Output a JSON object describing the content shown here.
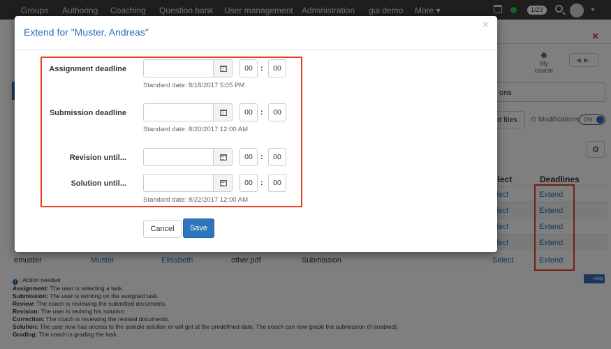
{
  "topnav": {
    "items": [
      "Groups",
      "Authoring",
      "Coaching",
      "Question bank",
      "User management",
      "Administration",
      "gui demo",
      "More ▾"
    ],
    "page_count": "1/23"
  },
  "background": {
    "my_course": "My course",
    "options_fragment": "ons",
    "files_fragment": "d files",
    "modifications": "Modifications",
    "toggle_state": "ON",
    "columns": {
      "select": "elect",
      "deadlines": "Deadlines"
    },
    "select_fragment": "elect",
    "extend_label": "Extend",
    "select_label": "Select",
    "emuster_row": {
      "login": "emuster",
      "lastname": "Muster",
      "firstname": "Elisabeth",
      "file": "other.pdf",
      "status": "Submission"
    },
    "legend": {
      "action_needed": ": Action needed",
      "items": [
        {
          "term": "Assignment:",
          "desc": " The user is selecting a task."
        },
        {
          "term": "Submission:",
          "desc": " The user is working on the assigned task."
        },
        {
          "term": "Review:",
          "desc": " The coach is reviewing the submitted documents."
        },
        {
          "term": "Revision:",
          "desc": " The user is revising his solution."
        },
        {
          "term": "Correction:",
          "desc": " The coach is reviewing the revised documents."
        },
        {
          "term": "Solution:",
          "desc": " The user now has access to the sample solution or will get at the predefined date. The coach can now grade the submission (if enabled)."
        },
        {
          "term": "Grading:",
          "desc": " The coach is grading the task."
        }
      ]
    },
    "help": "Help"
  },
  "modal": {
    "title": "Extend for \"Muster, Andreas\"",
    "close": "×",
    "fields": [
      {
        "label": "Assignment deadline",
        "date_value": "",
        "hour": "00",
        "minute": "00",
        "standard_date": "Standard date: 8/18/2017 5:05 PM"
      },
      {
        "label": "Submission deadline",
        "date_value": "",
        "hour": "00",
        "minute": "00",
        "standard_date": "Standard date: 8/20/2017 12:00 AM"
      },
      {
        "label": "Revision until...",
        "date_value": "",
        "hour": "00",
        "minute": "00",
        "standard_date": ""
      },
      {
        "label": "Solution until...",
        "date_value": "",
        "hour": "00",
        "minute": "00",
        "standard_date": "Standard date: 8/22/2017 12:00 AM"
      }
    ],
    "cancel_label": "Cancel",
    "save_label": "Save"
  },
  "colors": {
    "accent": "#2a6ebb",
    "highlight_frame": "#e8401c",
    "topbar": "#3d3d3d"
  }
}
